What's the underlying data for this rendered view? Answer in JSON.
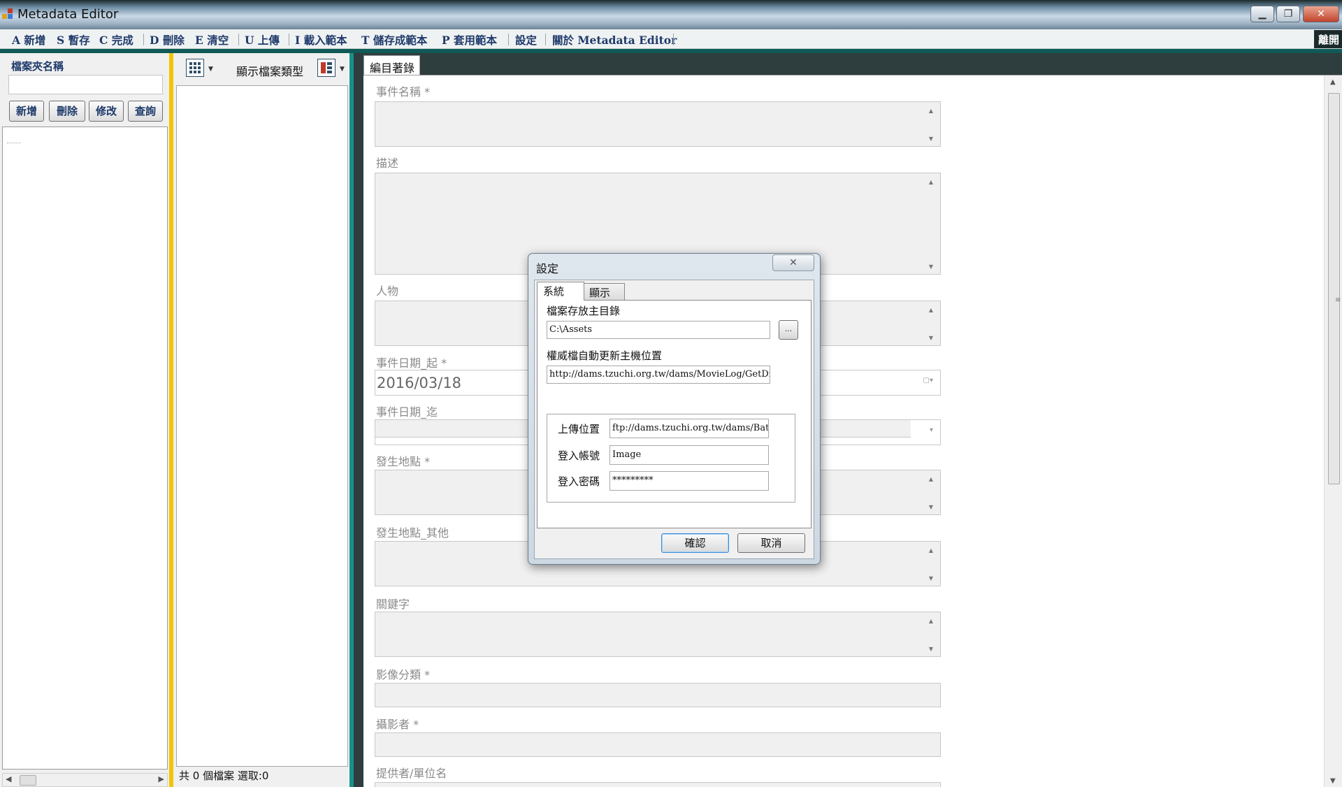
{
  "window": {
    "title": "Metadata Editor"
  },
  "menu": {
    "items": [
      "A 新增",
      "S 暫存",
      "C 完成",
      "D 刪除",
      "E 清空",
      "U 上傳",
      "I 載入範本",
      "T 儲存成範本",
      "P 套用範本",
      "設定",
      "關於 Metadata Editor"
    ],
    "right_tab": "離開"
  },
  "left_panel": {
    "folder_label": "檔案夾名稱",
    "folder_value": "",
    "buttons": [
      "新增",
      "刪除",
      "修改",
      "查詢"
    ]
  },
  "middle_panel": {
    "show_type_label": "顯示檔案類型",
    "status": "共 0 個檔案  選取:0"
  },
  "editor": {
    "tab": "編目著錄",
    "fields": {
      "event_name": "事件名稱 *",
      "description": "描述",
      "person": "人物",
      "date_from": "事件日期_起 *",
      "date_from_value": "2016/03/18",
      "date_to": "事件日期_迄",
      "place": "發生地點 *",
      "place_other": "發生地點_其他",
      "keywords": "關鍵字",
      "image_category": "影像分類 *",
      "photographer": "攝影者 *",
      "provider": "提供者/單位名"
    }
  },
  "dialog": {
    "title": "設定",
    "tabs": [
      "系統",
      "顯示"
    ],
    "home_dir_label": "檔案存放主目錄",
    "home_dir_value": "C:\\Assets",
    "browse_label": "...",
    "authority_label": "權威檔自動更新主機位置",
    "authority_value": "http://dams.tzuchi.org.tw/dams/MovieLog/GetDictionary",
    "upload_label": "上傳位置",
    "upload_value": "ftp://dams.tzuchi.org.tw/dams/BatchUpload",
    "account_label": "登入帳號",
    "account_value": "Image",
    "password_label": "登入密碼",
    "password_value": "*********",
    "ok_label": "確認",
    "cancel_label": "取消"
  },
  "colors": {
    "accent_teal": "#16908a",
    "gold_divider": "#f5c400",
    "menu_text": "#1f3a6b"
  }
}
